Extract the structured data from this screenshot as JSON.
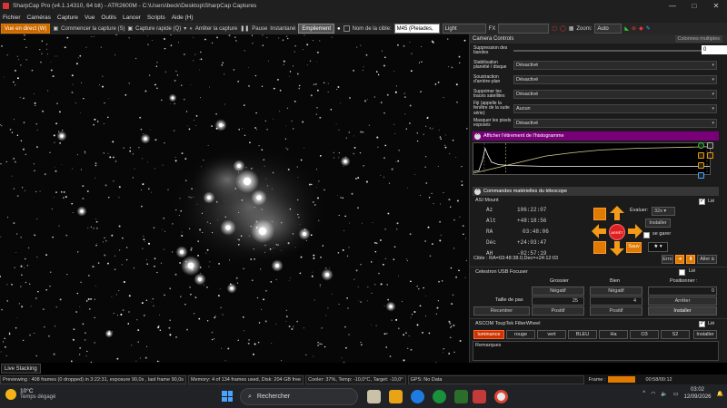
{
  "window": {
    "title": "SharpCap Pro (v4.1.14310, 64 bit) - ATR2600M - C:\\Users\\beck\\Desktop\\SharpCap Captures",
    "min": "—",
    "max": "□",
    "close": "✕"
  },
  "menu": [
    "Fichier",
    "Caméras",
    "Capture",
    "Vue",
    "Outils",
    "Lancer",
    "Scripts",
    "Aide (H)"
  ],
  "toolbar": {
    "live_view": "Vue en direct (W)",
    "start_capture": "Commencer la capture (S)",
    "quick_capture": "Capture rapide (Q)",
    "stop_capture": "Arrêter la capture",
    "pause": "Pause",
    "snapshot": "Instantané",
    "stacking": "Empilement",
    "target_label": "Nom de la cible:",
    "target_value": "M45 (Pleiades,",
    "filter_value": "Light",
    "fx_label": "FX",
    "zoom_label": "Zoom:",
    "zoom_value": "Auto"
  },
  "panel": {
    "header": "Camera Controls",
    "columns_multiples": "Colonnes multiples",
    "rows": [
      {
        "label": "Suppression des bandes",
        "value": "0",
        "type": "slider"
      },
      {
        "label": "Stabilisation planéité / disque",
        "value": "Désactivé"
      },
      {
        "label": "Soustraction d'arrière-plan",
        "value": "Désactivé"
      },
      {
        "label": "Supprimer les traces satellites",
        "value": "Désactivé"
      },
      {
        "label": "Fiji (appelle la fenêtre de la suite série)",
        "value": "Aucun"
      },
      {
        "label": "Masquer les pixels exposés",
        "value": "Désactivé"
      }
    ],
    "histogram_title": "Afficher l'étirement de l'histogramme",
    "mount_section": "Commandes matérielles du télescope",
    "mount": {
      "name": "ASI Mount",
      "linked": "Lié",
      "evaluate_label": "Évaluer:",
      "evaluate_value": "32x",
      "install": "Installer",
      "park": "se garer",
      "stop": "ARRÊT",
      "save": "Sauv",
      "error": "Erro",
      "goto": "Aller à",
      "coords": [
        {
          "k": "Az",
          "v": "106:22:07"
        },
        {
          "k": "Alt",
          "v": "+48:18:56"
        },
        {
          "k": "RA",
          "v": "03:48:06"
        },
        {
          "k": "Déc",
          "v": "+24:03:47"
        },
        {
          "k": "AH",
          "v": "-02:57:19"
        }
      ],
      "target": "Cible : RA=03:48:38.0,Dec=+24:12:03"
    },
    "focuser": {
      "name": "Celestron USB Focuser",
      "linked": "Lié",
      "col_coarse": "Grossier",
      "col_fine": "Bien",
      "col_position": "Positionner :",
      "neg1": "Négatif",
      "neg2": "Négatif",
      "pos_value": "0",
      "step_label": "Taille de pas",
      "step_coarse": "25",
      "step_fine": "4",
      "stop": "Arrêter",
      "recenter": "Recentrer",
      "posi1": "Positif",
      "posi2": "Positif",
      "install": "Installer"
    },
    "filterwheel": {
      "name": "ASCOM ToupTek FilterWheel",
      "linked": "Lié",
      "filters": [
        "luminance",
        "rouge",
        "vert",
        "BLEU",
        "Ha",
        "O3",
        "S2"
      ],
      "selected": "luminance",
      "install": "Installer"
    },
    "remarks": "Remarques"
  },
  "status": {
    "live_stacking": "Live Stacking",
    "previewing": "Previewing : 408 frames (0 dropped) in 3:22:31, exposure 90,0s , last frame 90,0s",
    "memory": "Memory: 4 of 134 frames used, Disk: 204 GB free",
    "cooler": "Cooler: 37%, Temp: -10,0°C, Target: -10,0°",
    "gps": "GPS: No Data",
    "frame_label": "Frame :",
    "frame_time": "00:58/00:12"
  },
  "taskbar": {
    "temp": "10°C",
    "weather": "Temps dégagé",
    "search": "Rechercher",
    "time": "03:02",
    "date": "12/09/2026"
  }
}
